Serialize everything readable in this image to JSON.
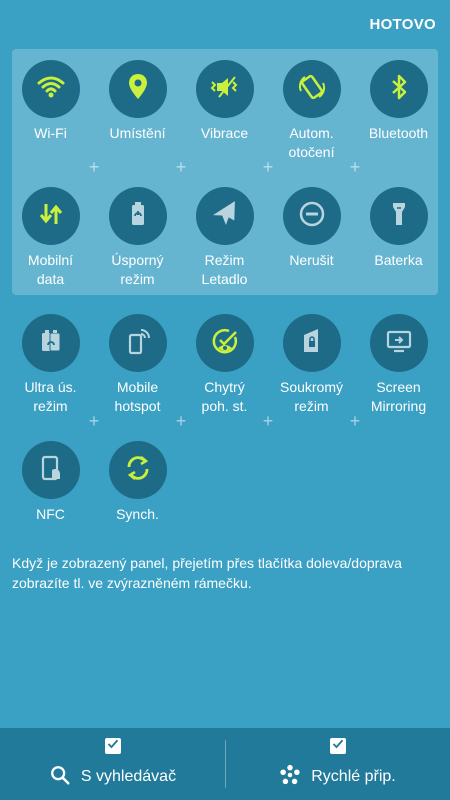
{
  "header": {
    "done_label": "HOTOVO"
  },
  "tiles": [
    {
      "label": "Wi-Fi",
      "icon": "wifi-icon"
    },
    {
      "label": "Umístění",
      "icon": "location-icon"
    },
    {
      "label": "Vibrace",
      "icon": "vibrate-icon"
    },
    {
      "label": "Autom.\notočení",
      "icon": "auto-rotate-icon"
    },
    {
      "label": "Bluetooth",
      "icon": "bluetooth-icon"
    },
    {
      "label": "Mobilní\ndata",
      "icon": "mobile-data-icon"
    },
    {
      "label": "Úsporný\nrežim",
      "icon": "power-saving-icon"
    },
    {
      "label": "Režim\nLetadlo",
      "icon": "airplane-icon"
    },
    {
      "label": "Nerušit",
      "icon": "do-not-disturb-icon"
    },
    {
      "label": "Baterka",
      "icon": "flashlight-icon"
    },
    {
      "label": "Ultra ús.\nrežim",
      "icon": "ultra-power-saving-icon"
    },
    {
      "label": "Mobile\nhotspot",
      "icon": "hotspot-icon"
    },
    {
      "label": "Chytrý\npoh. st.",
      "icon": "smart-stay-icon"
    },
    {
      "label": "Soukromý\nrežim",
      "icon": "private-mode-icon"
    },
    {
      "label": "Screen\nMirroring",
      "icon": "screen-mirroring-icon"
    },
    {
      "label": "NFC",
      "icon": "nfc-icon"
    },
    {
      "label": "Synch.",
      "icon": "sync-icon"
    }
  ],
  "hint": "Když je zobrazený panel, přejetím přes tlačítka doleva/doprava zobrazíte tl. ve zvýrazněném rámečku.",
  "bottom": {
    "finder_label": "S vyhledávač",
    "quick_label": "Rychlé přip."
  },
  "colors": {
    "background": "#3aa0c4",
    "tile_circle": "#1e6b88",
    "icon_active": "#c8f03c",
    "icon_inactive": "#b8d4de",
    "bottom_bar": "#227a9b"
  }
}
